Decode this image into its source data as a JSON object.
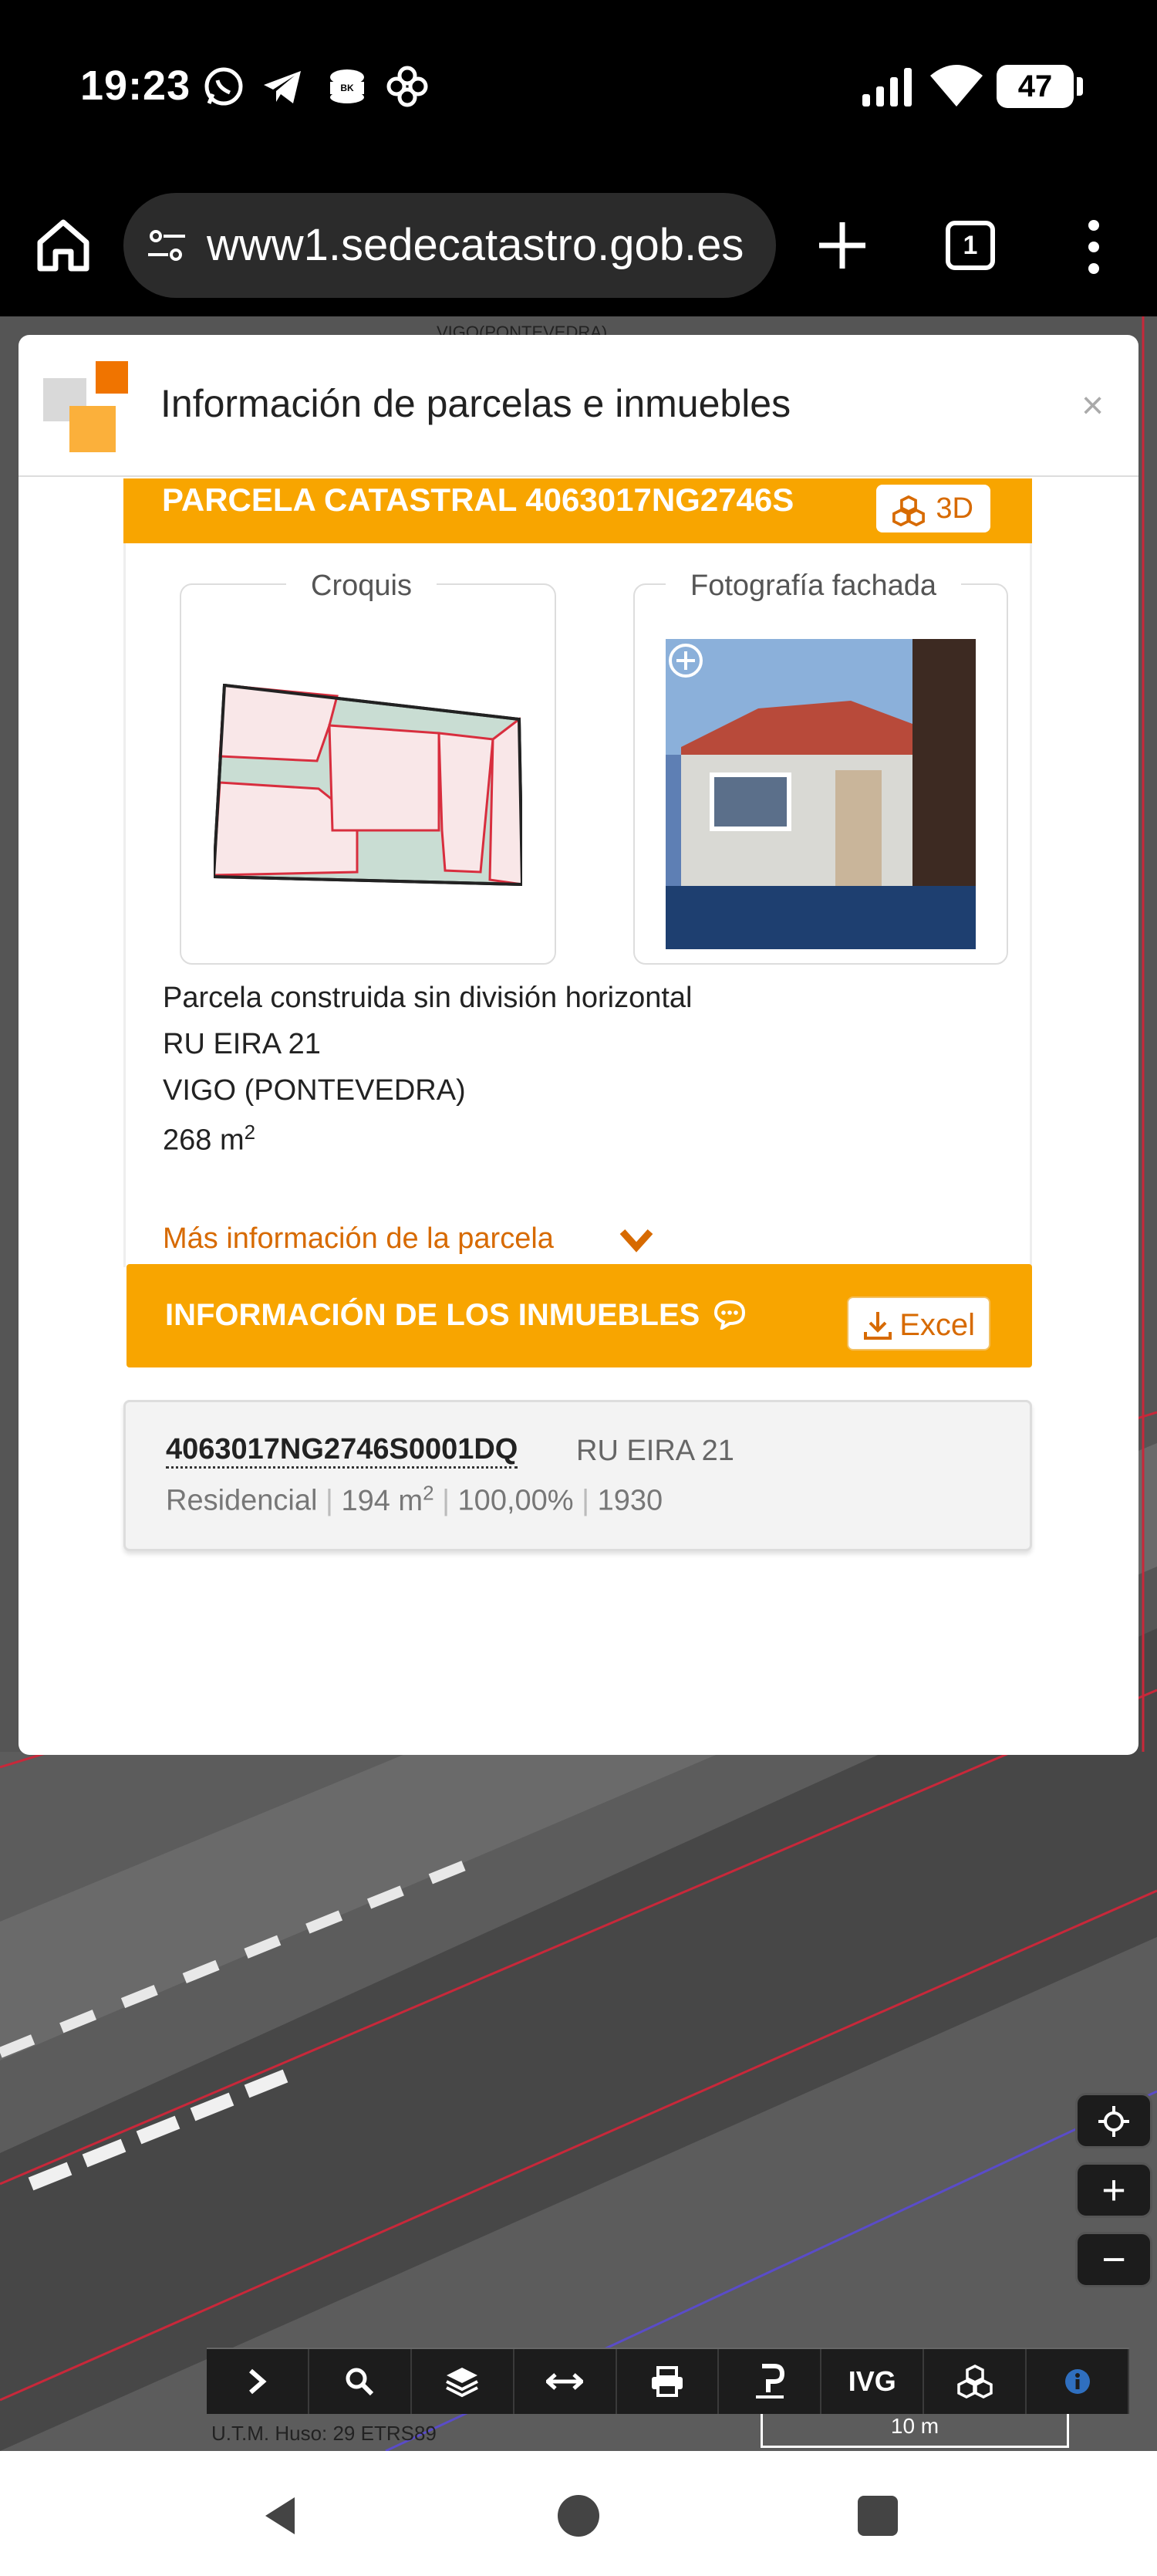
{
  "status_bar": {
    "time": "19:23",
    "icons": [
      "whatsapp-icon",
      "telegram-icon",
      "burger-king-icon",
      "flower-icon"
    ],
    "battery": "47"
  },
  "browser": {
    "url": "www1.sedecatastro.gob.es",
    "tab_count": "1"
  },
  "modal": {
    "title": "Información de parcelas e inmuebles",
    "close": "×",
    "parcel": {
      "header_title": "PARCELA CATASTRAL 4063017NG2746S",
      "btn_3d": "3D",
      "sketch_label": "Croquis",
      "photo_label": "Fotografía fachada",
      "type": "Parcela construida sin división horizontal",
      "address": "RU EIRA 21",
      "city": "VIGO (PONTEVEDRA)",
      "area_value": "268 m",
      "area_exp": "2",
      "more_info": "Más información de la parcela"
    },
    "properties": {
      "header_title": "INFORMACIÓN DE LOS INMUEBLES",
      "excel_label": "Excel",
      "rows": [
        {
          "ref": "4063017NG2746S0001DQ",
          "address": "RU EIRA 21",
          "use": "Residencial",
          "area": "194 m",
          "area_exp": "2",
          "share": "100,00%",
          "year": "1930"
        }
      ]
    }
  },
  "map": {
    "label": "VIGO(PONTEVEDRA)",
    "utm": "U.T.M. Huso: 29 ETRS89",
    "scale": "10 m",
    "controls": {
      "zoom_in": "+",
      "zoom_out": "−"
    },
    "toolbar": {
      "ivg_label": "IVG"
    }
  },
  "colors": {
    "accent": "#f8a500",
    "accent_text": "#d76a00"
  }
}
